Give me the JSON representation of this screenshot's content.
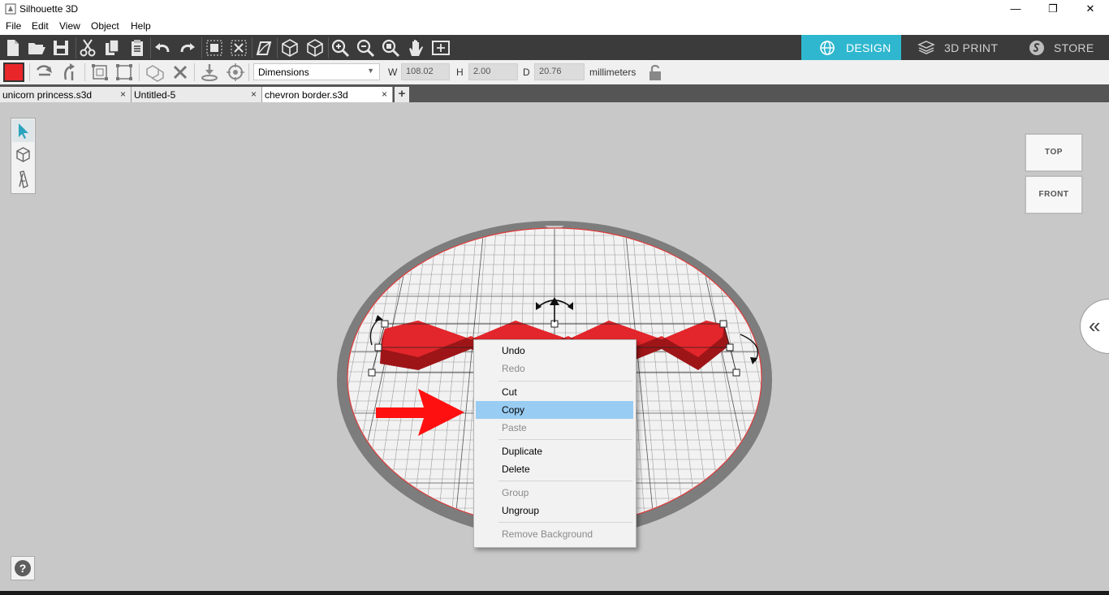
{
  "window": {
    "title": "Silhouette 3D",
    "minimize_glyph": "—",
    "restore_glyph": "❐",
    "close_glyph": "✕"
  },
  "menu": [
    "File",
    "Edit",
    "View",
    "Object",
    "Help"
  ],
  "mode_tabs": {
    "design": "DESIGN",
    "print": "3D PRINT",
    "store": "STORE"
  },
  "colors": {
    "accent": "#2fb7cf",
    "object_red": "#e8262a",
    "menu_highlight": "#99ccf2"
  },
  "properties": {
    "mode_select": "Dimensions",
    "w_label": "W",
    "w_value": "108.02",
    "h_label": "H",
    "h_value": "2.00",
    "d_label": "D",
    "d_value": "20.76",
    "units": "millimeters"
  },
  "doc_tabs": [
    {
      "name": "unicorn princess.s3d",
      "close": "×"
    },
    {
      "name": "Untitled-5",
      "close": "×"
    },
    {
      "name": "chevron border.s3d",
      "close": "×"
    }
  ],
  "add_tab": "+",
  "view_cube": {
    "top": "TOP",
    "front": "FRONT"
  },
  "collapse_glyph": "«",
  "help_glyph": "?",
  "context_menu": {
    "items": [
      {
        "label": "Undo",
        "enabled": true
      },
      {
        "label": "Redo",
        "enabled": false
      },
      {
        "label": "Cut",
        "enabled": true
      },
      {
        "label": "Copy",
        "enabled": true,
        "highlighted": true
      },
      {
        "label": "Paste",
        "enabled": false
      },
      {
        "label": "Duplicate",
        "enabled": true
      },
      {
        "label": "Delete",
        "enabled": true
      },
      {
        "label": "Group",
        "enabled": false
      },
      {
        "label": "Ungroup",
        "enabled": true
      },
      {
        "label": "Remove Background",
        "enabled": false
      }
    ]
  },
  "icons": {
    "toolbar": [
      "new-file-icon",
      "open-folder-icon",
      "save-icon",
      "cut-icon",
      "copy-icon",
      "paste-icon",
      "undo-icon",
      "redo-icon",
      "select-all-icon",
      "deselect-icon",
      "perspective-icon",
      "box-view-icon",
      "box-wire-icon",
      "zoom-in-icon",
      "zoom-out-icon",
      "zoom-fit-icon",
      "pan-hand-icon",
      "fit-page-icon"
    ],
    "toolbar2": [
      "color-swatch",
      "rotate-icon",
      "flip-icon",
      "group-bounds-icon",
      "ungroup-bounds-icon",
      "boolean-icon",
      "delete-icon",
      "drop-to-plate-icon",
      "center-icon",
      "lock-icon"
    ],
    "tools": [
      "select-arrow-icon",
      "shape-box-icon",
      "text-tool-icon"
    ]
  }
}
